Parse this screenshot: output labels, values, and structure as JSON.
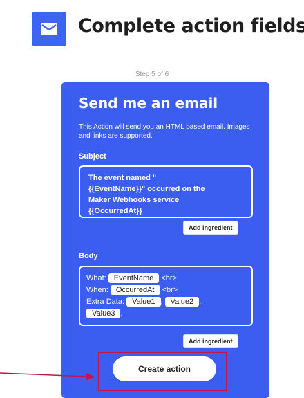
{
  "header": {
    "service_icon": "envelope-icon",
    "title": "Complete action fields",
    "step": "Step 5 of 6"
  },
  "action": {
    "title": "Send me an email",
    "description": "This Action will send you an HTML based email. Images and links are supported.",
    "subject": {
      "label": "Subject",
      "lines": [
        "The event named \"",
        "{{EventName}}\" occurred on the",
        "Maker Webhooks service",
        "{{OccurredAt}}"
      ],
      "add_ingredient_label": "Add ingredient"
    },
    "body": {
      "label": "Body",
      "line1_prefix": "What:",
      "line1_ingredient": "EventName",
      "line1_suffix": "<br>",
      "line2_prefix": "When:",
      "line2_ingredient": "OccurredAt",
      "line2_suffix": "<br>",
      "line3_prefix": "Extra Data:",
      "line3_ingredient1": "Value1",
      "line3_sep": ",",
      "line3_ingredient2": "Value2",
      "line3_sep2": ",",
      "line4_ingredient": "Value3",
      "line4_suffix": ",",
      "add_ingredient_label": "Add ingredient"
    },
    "create_button_label": "Create action"
  },
  "colors": {
    "card": "#3c5ef0",
    "icon_bg": "#3d64f2",
    "annotation": "#c3154a"
  }
}
